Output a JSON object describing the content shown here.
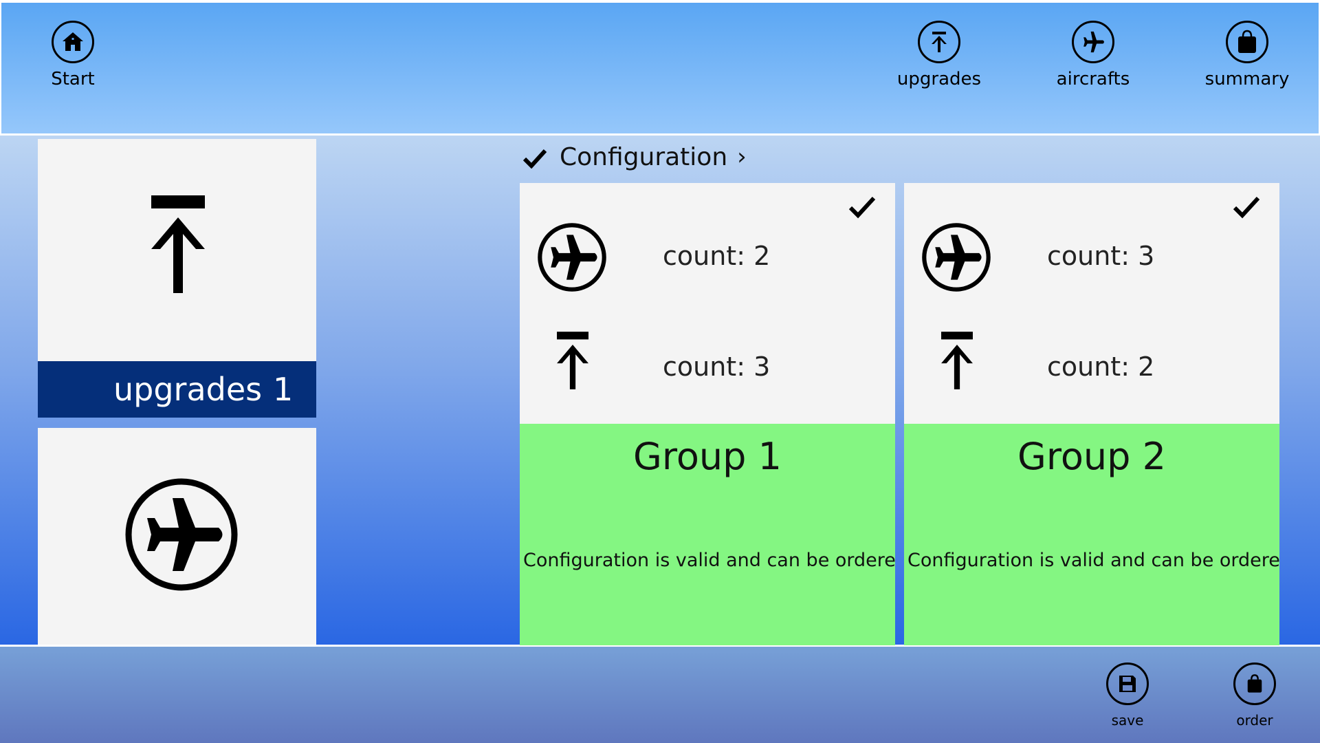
{
  "top_bar": {
    "start_label": "Start",
    "upgrades_label": "upgrades",
    "aircrafts_label": "aircrafts",
    "summary_label": "summary"
  },
  "left_tiles": {
    "upgrades": {
      "label": "upgrades",
      "count": "1",
      "icon": "upload-icon"
    },
    "aircrafts": {
      "icon": "airplane-icon"
    }
  },
  "breadcrumb": {
    "label": "Configuration",
    "check_icon": "checkmark-icon",
    "chevron": "›"
  },
  "groups": [
    {
      "title": "Group 1",
      "aircraft_count": "count: 2",
      "upgrade_count": "count: 3",
      "status": "Configuration is valid and can be ordered"
    },
    {
      "title": "Group 2",
      "aircraft_count": "count: 3",
      "upgrade_count": "count: 2",
      "status": "Configuration is valid and can be ordered"
    }
  ],
  "bottom_bar": {
    "save_label": "save",
    "order_label": "order"
  },
  "colors": {
    "valid_green": "#84f682",
    "tile_label_bg": "#052f7a"
  }
}
